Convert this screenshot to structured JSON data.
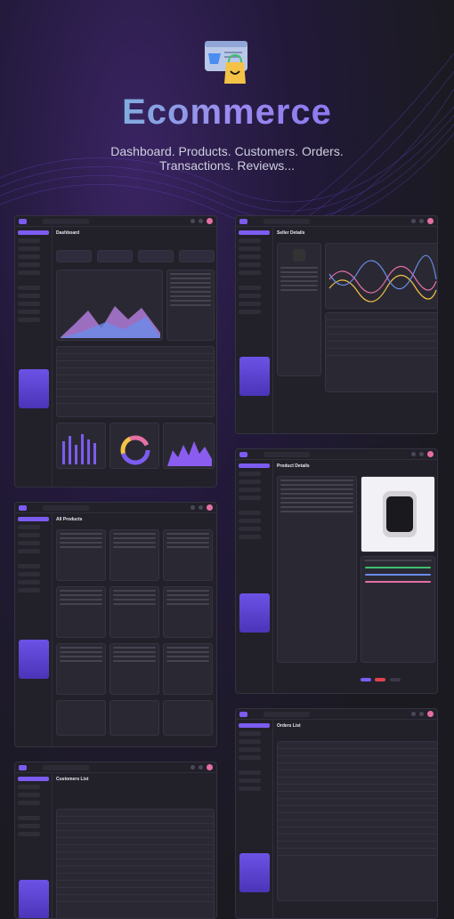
{
  "hero": {
    "title": "Ecommerce",
    "subtitle_line1": "Dashboard. Products. Customers. Orders.",
    "subtitle_line2": "Transactions. Reviews..."
  },
  "screens": {
    "dashboard": {
      "title": "Dashboard"
    },
    "seller_details": {
      "title": "Seller Details"
    },
    "product_details": {
      "title": "Product Details"
    },
    "all_products": {
      "title": "All Products"
    },
    "orders_list": {
      "title": "Orders List"
    },
    "customers_list": {
      "title": "Customers List"
    }
  },
  "colors": {
    "accent": "#7c5cf0",
    "pink": "#e56fa5",
    "teal": "#5fd3c6",
    "yellow": "#f3c246"
  },
  "icons": {
    "hero": "shopping-bag-icon"
  }
}
